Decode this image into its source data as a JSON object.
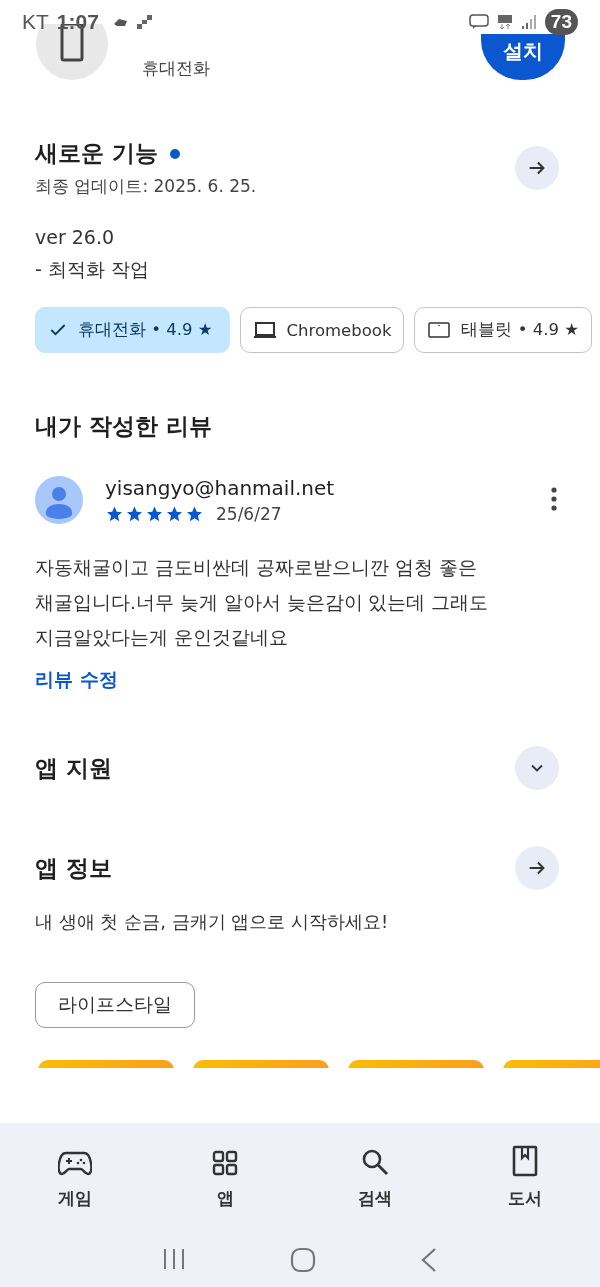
{
  "status_bar": {
    "carrier": "KT",
    "time": "1:07",
    "battery": "73"
  },
  "app": {
    "category": "휴대전화",
    "install_button": "설치"
  },
  "whats_new": {
    "title": "새로운 기능",
    "new_dot": true,
    "updated": "최종 업데이트: 2025. 6. 25.",
    "notes": [
      "ver 26.0",
      "- 최적화 작업"
    ]
  },
  "device_chips": [
    {
      "label": "휴대전화 • 4.9 ★",
      "selected": true
    },
    {
      "kind": "laptop",
      "label": "Chromebook",
      "selected": false
    },
    {
      "kind": "tablet",
      "label": "태블릿 • 4.9 ★",
      "selected": false
    }
  ],
  "my_review": {
    "title": "내가 작성한 리뷰",
    "author": "yisangyo@hanmail.net",
    "stars": 5,
    "date": "25/6/27",
    "text": "자동채굴이고 금도비싼데 공짜로받으니깐 엄청 좋은 채굴입니다.너무 늦게 알아서 늦은감이 있는데 그래도 지금알았다는게 운인것같네요",
    "edit_link": "리뷰 수정"
  },
  "sections": [
    {
      "kind": "expand",
      "title": "앱 지원"
    },
    {
      "kind": "arrow",
      "title": "앱 정보",
      "description": "내 생애 첫 순금, 금캐기 앱으로 시작하세요!"
    }
  ],
  "tags": [
    "라이프스타일"
  ],
  "bottom_nav": [
    {
      "kind": "games",
      "label": "게임"
    },
    {
      "kind": "apps",
      "label": "앱"
    },
    {
      "kind": "search",
      "label": "검색"
    },
    {
      "kind": "books",
      "label": "도서"
    }
  ]
}
